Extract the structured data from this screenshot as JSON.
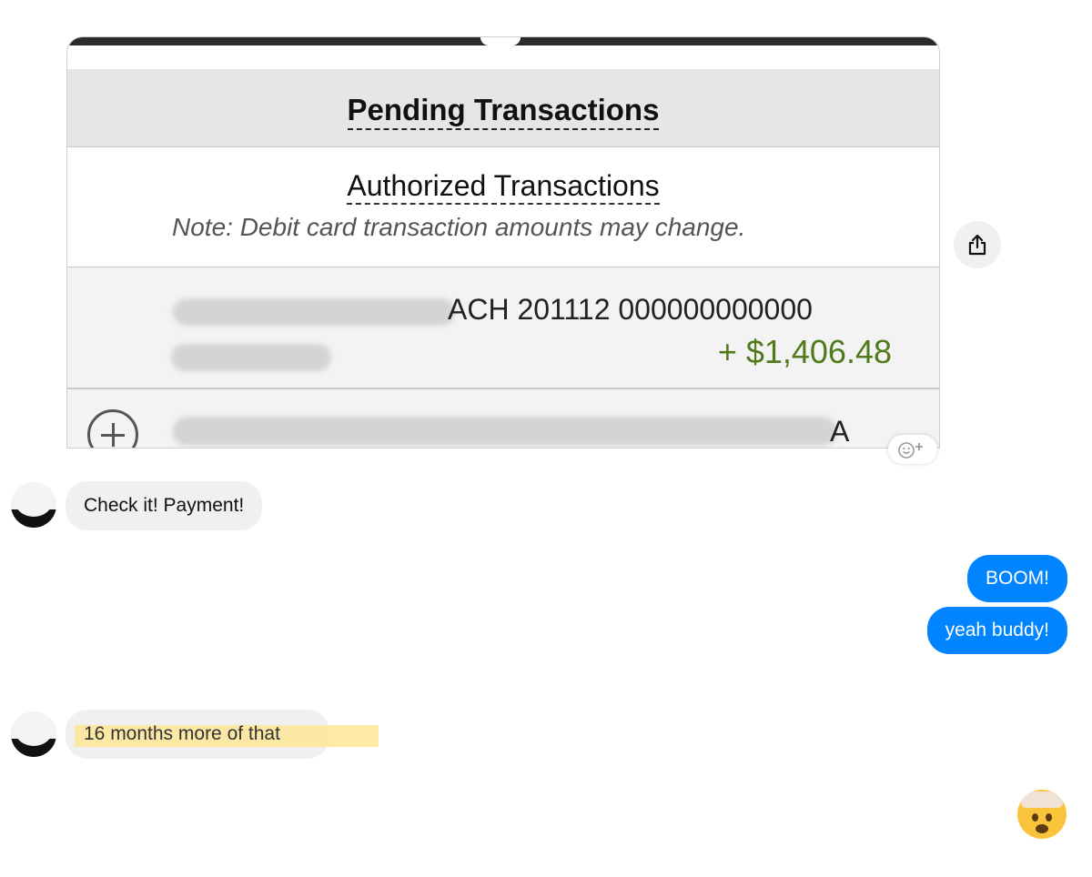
{
  "shared_image": {
    "header_title": "Pending Transactions",
    "section_title": "Authorized Transactions",
    "note": "Note: Debit card transaction amounts may change.",
    "row1_description_visible": "ACH 201112 000000000000",
    "row1_amount": "+  $1,406.48",
    "row2_description_visible": "A"
  },
  "messages": {
    "received_1": "Check it! Payment!",
    "sent_1": "BOOM!",
    "sent_2": "yeah buddy!",
    "received_2": "16 months more of that"
  },
  "icons": {
    "share": "share-icon",
    "react": "add-reaction-icon",
    "reaction_emoji": "exploding-head-emoji"
  },
  "colors": {
    "sent_bubble": "#0084ff",
    "received_bubble": "#f0f0f0",
    "amount_green": "#4f7b1c",
    "highlight": "#fbe697"
  }
}
